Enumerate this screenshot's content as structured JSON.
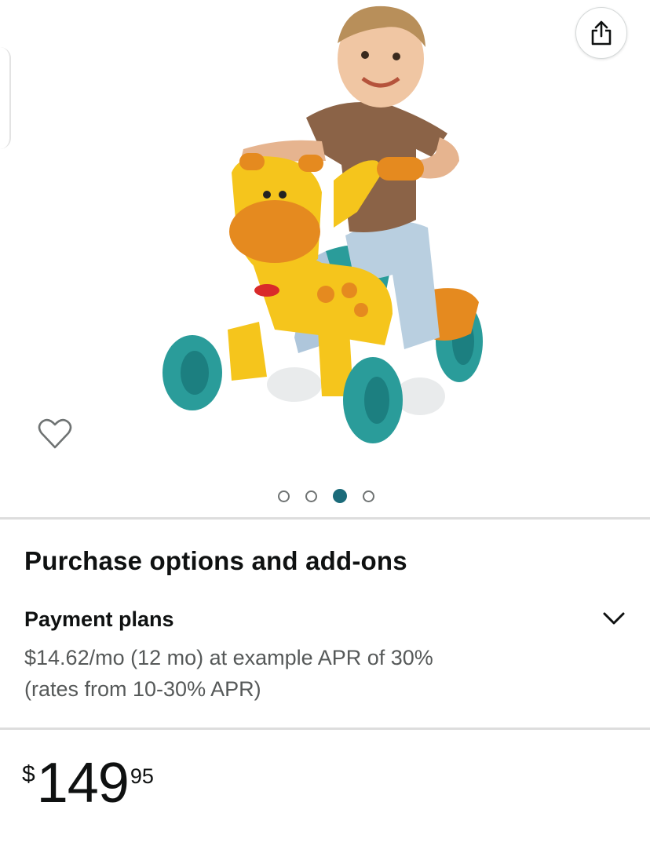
{
  "gallery": {
    "share_icon": "share-icon",
    "wishlist_icon": "heart-outline-icon",
    "image_count": 4,
    "active_index": 3
  },
  "purchase": {
    "title": "Purchase options and add-ons"
  },
  "payment_plans": {
    "label": "Payment plans",
    "line1": "$14.62/mo (12 mo) at example APR of 30%",
    "line2": "(rates from 10-30% APR)",
    "expand_icon": "chevron-down-icon"
  },
  "price": {
    "symbol": "$",
    "whole": "149",
    "fraction": "95"
  },
  "colors": {
    "active_dot": "#1b6b7a",
    "text": "#0f1111",
    "secondary_text": "#565959",
    "divider": "#dddddd"
  }
}
